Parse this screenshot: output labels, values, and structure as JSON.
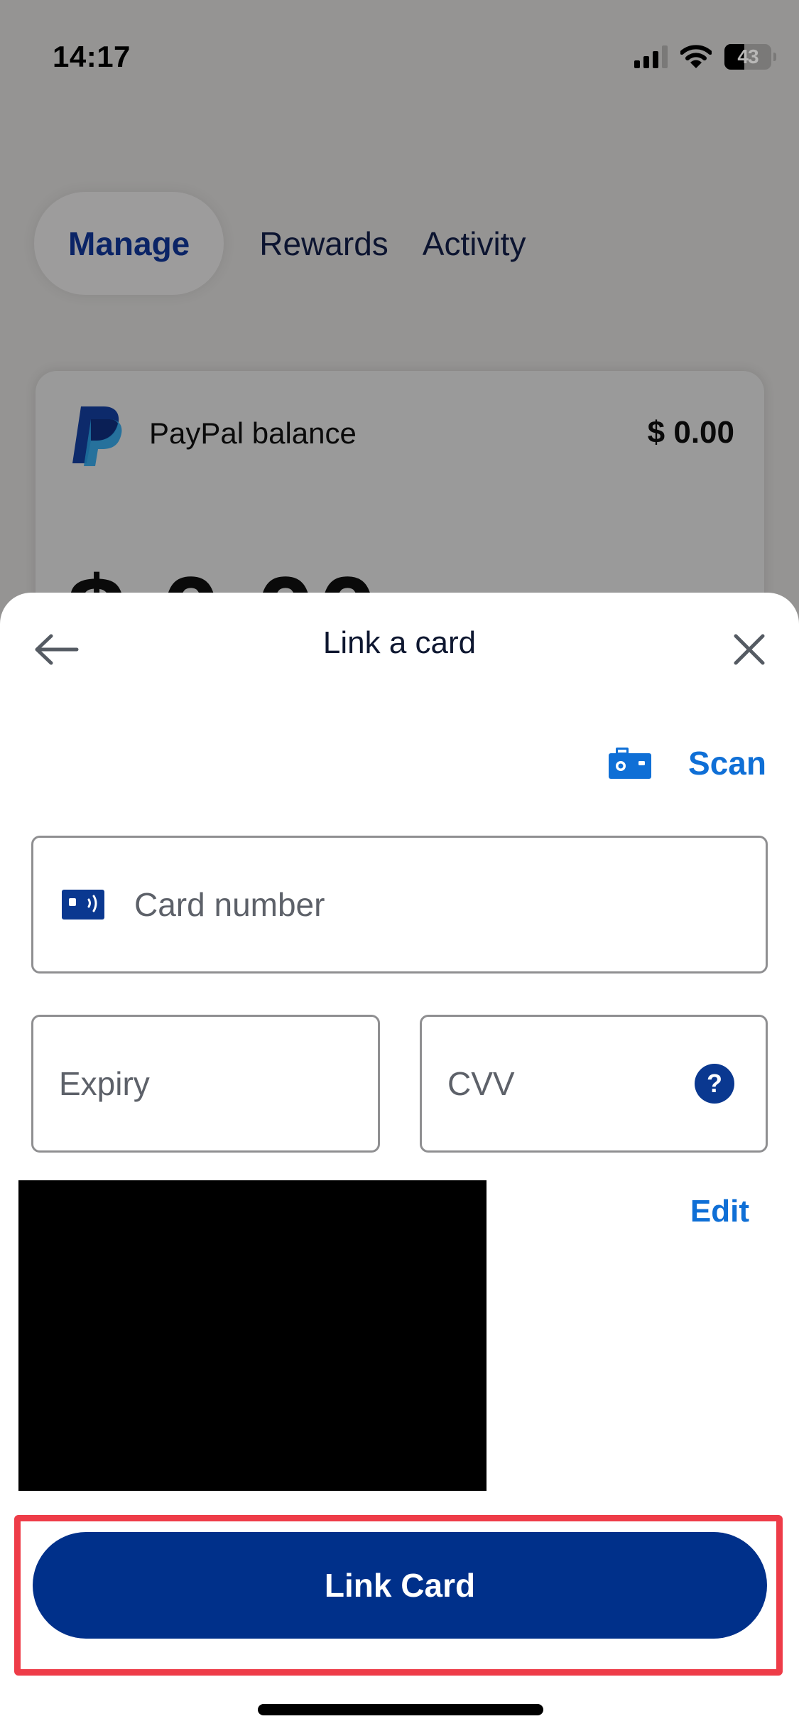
{
  "status_bar": {
    "time": "14:17",
    "signal_bars": 3,
    "signal_bars_total": 4,
    "wifi_icon": "wifi-icon",
    "battery_percent": 43
  },
  "background": {
    "tabs": [
      {
        "label": "Manage",
        "active": true
      },
      {
        "label": "Rewards",
        "active": false
      },
      {
        "label": "Activity",
        "active": false
      }
    ],
    "balance_card": {
      "logo_icon": "paypal-logo",
      "label": "PayPal balance",
      "amount_small": "$ 0.00",
      "amount_large": "$ 0.00"
    }
  },
  "sheet": {
    "title": "Link a card",
    "back_icon": "arrow-left-icon",
    "close_icon": "close-icon",
    "scan": {
      "icon": "camera-icon",
      "label": "Scan"
    },
    "fields": {
      "card_number": {
        "placeholder": "Card number",
        "value": "",
        "icon": "card-contactless-icon"
      },
      "expiry": {
        "placeholder": "Expiry",
        "value": ""
      },
      "cvv": {
        "placeholder": "CVV",
        "value": "",
        "help_icon": "question-icon",
        "help_glyph": "?"
      }
    },
    "edit_label": "Edit",
    "submit_label": "Link Card"
  },
  "colors": {
    "brand_navy": "#00308a",
    "link_blue": "#0f6fd6",
    "highlight_red": "#ee3c48",
    "overlay": "#959493"
  }
}
